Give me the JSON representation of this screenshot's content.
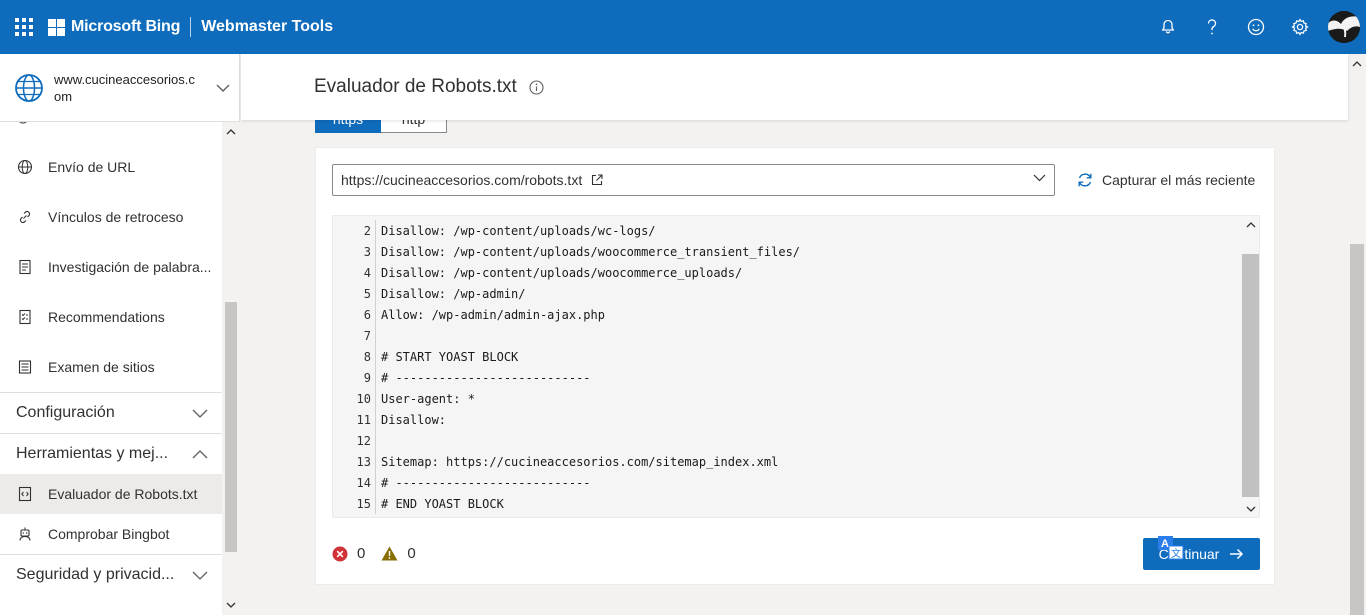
{
  "header": {
    "brand": "Microsoft Bing",
    "product": "Webmaster Tools",
    "accent_color": "#0f6cbd"
  },
  "site": {
    "name": "www.cucineaccesorios.com"
  },
  "sidebar": {
    "items": [
      {
        "label": "Envío de URL",
        "icon": "globe-icon"
      },
      {
        "label": "Vínculos de retroceso",
        "icon": "link-icon"
      },
      {
        "label": "Investigación de palabra...",
        "icon": "document-search-icon"
      },
      {
        "label": "Recommendations",
        "icon": "checklist-icon"
      },
      {
        "label": "Examen de sitios",
        "icon": "site-scan-icon"
      }
    ],
    "sections": {
      "config": "Configuración",
      "tools": "Herramientas y mej...",
      "security": "Seguridad y privacid..."
    },
    "tool_items": [
      {
        "label": "Evaluador de Robots.txt",
        "icon": "code-file-icon",
        "active": true
      },
      {
        "label": "Comprobar Bingbot",
        "icon": "robot-icon",
        "active": false
      }
    ]
  },
  "page": {
    "title": "Evaluador de Robots.txt"
  },
  "protocol_tabs": {
    "https": "https",
    "http": "http",
    "selected": "https"
  },
  "tester": {
    "url_value": "https://cucineaccesorios.com/robots.txt",
    "fetch_label": "Capturar el más reciente",
    "lines": [
      {
        "n": "2",
        "text": "Disallow: /wp-content/uploads/wc-logs/"
      },
      {
        "n": "3",
        "text": "Disallow: /wp-content/uploads/woocommerce_transient_files/"
      },
      {
        "n": "4",
        "text": "Disallow: /wp-content/uploads/woocommerce_uploads/"
      },
      {
        "n": "5",
        "text": "Disallow: /wp-admin/"
      },
      {
        "n": "6",
        "text": "Allow: /wp-admin/admin-ajax.php"
      },
      {
        "n": "7",
        "text": ""
      },
      {
        "n": "8",
        "text": "# START YOAST BLOCK"
      },
      {
        "n": "9",
        "text": "# ---------------------------"
      },
      {
        "n": "10",
        "text": "User-agent: *"
      },
      {
        "n": "11",
        "text": "Disallow:"
      },
      {
        "n": "12",
        "text": ""
      },
      {
        "n": "13",
        "text": "Sitemap: https://cucineaccesorios.com/sitemap_index.xml"
      },
      {
        "n": "14",
        "text": "# ---------------------------"
      },
      {
        "n": "15",
        "text": "# END YOAST BLOCK"
      }
    ],
    "error_count": "0",
    "warning_count": "0",
    "continue_label": "Continuar",
    "error_color": "#d13438",
    "warning_color": "#8a6d00"
  }
}
